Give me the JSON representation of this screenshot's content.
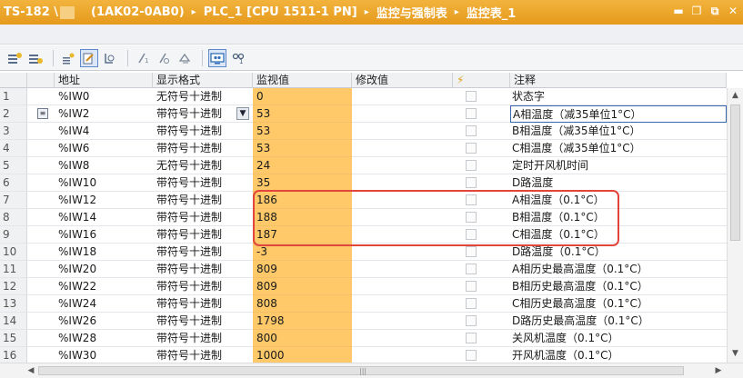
{
  "title": {
    "project": "TS-182 \\",
    "device": "(1AK02-0AB0)",
    "plc": "PLC_1 [CPU 1511-1 PN]",
    "folder": "监控与强制表",
    "table": "监控表_1",
    "separator": "▸"
  },
  "window_controls": {
    "minimize": "▬",
    "restore": "❐",
    "float": "⧉",
    "close": "✕"
  },
  "columns": {
    "address": "地址",
    "format": "显示格式",
    "monitor": "监视值",
    "modify": "修改值",
    "flag": "⚡",
    "comment": "注释"
  },
  "rows": [
    {
      "n": "1",
      "addr": "%IW0",
      "fmt": "无符号十进制",
      "val": "0",
      "cmt": "状态字"
    },
    {
      "n": "2",
      "addr": "%IW2",
      "fmt": "带符号十进制",
      "val": "53",
      "cmt": "A相温度（减35单位1°C）"
    },
    {
      "n": "3",
      "addr": "%IW4",
      "fmt": "带符号十进制",
      "val": "53",
      "cmt": "B相温度（减35单位1°C）"
    },
    {
      "n": "4",
      "addr": "%IW6",
      "fmt": "带符号十进制",
      "val": "53",
      "cmt": "C相温度（减35单位1°C）"
    },
    {
      "n": "5",
      "addr": "%IW8",
      "fmt": "无符号十进制",
      "val": "24",
      "cmt": "定时开风机时间"
    },
    {
      "n": "6",
      "addr": "%IW10",
      "fmt": "带符号十进制",
      "val": "35",
      "cmt": "D路温度"
    },
    {
      "n": "7",
      "addr": "%IW12",
      "fmt": "带符号十进制",
      "val": "186",
      "cmt": "A相温度（0.1°C）"
    },
    {
      "n": "8",
      "addr": "%IW14",
      "fmt": "带符号十进制",
      "val": "188",
      "cmt": "B相温度（0.1°C）"
    },
    {
      "n": "9",
      "addr": "%IW16",
      "fmt": "带符号十进制",
      "val": "187",
      "cmt": "C相温度（0.1°C）"
    },
    {
      "n": "10",
      "addr": "%IW18",
      "fmt": "带符号十进制",
      "val": "-3",
      "cmt": "D路温度（0.1°C）"
    },
    {
      "n": "11",
      "addr": "%IW20",
      "fmt": "带符号十进制",
      "val": "809",
      "cmt": "A相历史最高温度（0.1°C）"
    },
    {
      "n": "12",
      "addr": "%IW22",
      "fmt": "带符号十进制",
      "val": "809",
      "cmt": "B相历史最高温度（0.1°C）"
    },
    {
      "n": "13",
      "addr": "%IW24",
      "fmt": "带符号十进制",
      "val": "808",
      "cmt": "C相历史最高温度（0.1°C）"
    },
    {
      "n": "14",
      "addr": "%IW26",
      "fmt": "带符号十进制",
      "val": "1798",
      "cmt": "D路历史最高温度（0.1°C）"
    },
    {
      "n": "15",
      "addr": "%IW28",
      "fmt": "带符号十进制",
      "val": "800",
      "cmt": "关风机温度（0.1°C）"
    },
    {
      "n": "16",
      "addr": "%IW30",
      "fmt": "带符号十进制",
      "val": "1000",
      "cmt": "开风机温度（0.1°C）"
    }
  ],
  "selected_row": 2,
  "toolbar_icons": [
    "insert-row-icon",
    "add-row-icon",
    "show-all-icon",
    "monitor-once-icon",
    "force-icon",
    "modify-now-icon",
    "modify-trigger-icon",
    "enable-peripheral-icon",
    "monitor-all-icon",
    "monitor-once-now-icon"
  ],
  "colors": {
    "titlebar": "#e9a22a",
    "monitor_column": "#ffc96a",
    "annotation": "#e2453b"
  }
}
